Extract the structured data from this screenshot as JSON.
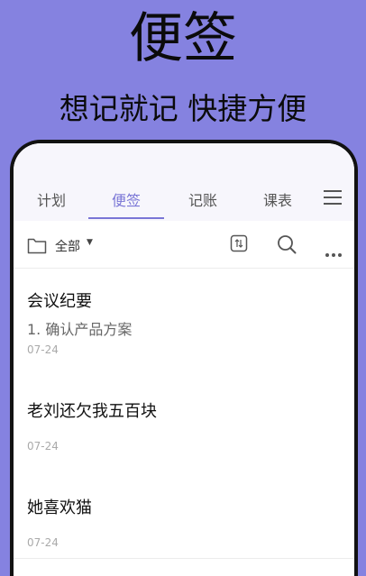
{
  "promo": {
    "title": "便签",
    "subtitle": "想记就记 快捷方便"
  },
  "tabs": [
    {
      "label": "计划",
      "active": false
    },
    {
      "label": "便签",
      "active": true
    },
    {
      "label": "记账",
      "active": false
    },
    {
      "label": "课表",
      "active": false
    }
  ],
  "toolbar": {
    "filter_label": "全部"
  },
  "notes": [
    {
      "title": "会议纪要",
      "body": "1. 确认产品方案",
      "date": "07-24"
    },
    {
      "title": "老刘还欠我五百块",
      "body": "",
      "date": "07-24"
    },
    {
      "title": "她喜欢猫",
      "body": "",
      "date": "07-24"
    }
  ],
  "colors": {
    "background": "#8582e0",
    "accent": "#7a76d6"
  }
}
